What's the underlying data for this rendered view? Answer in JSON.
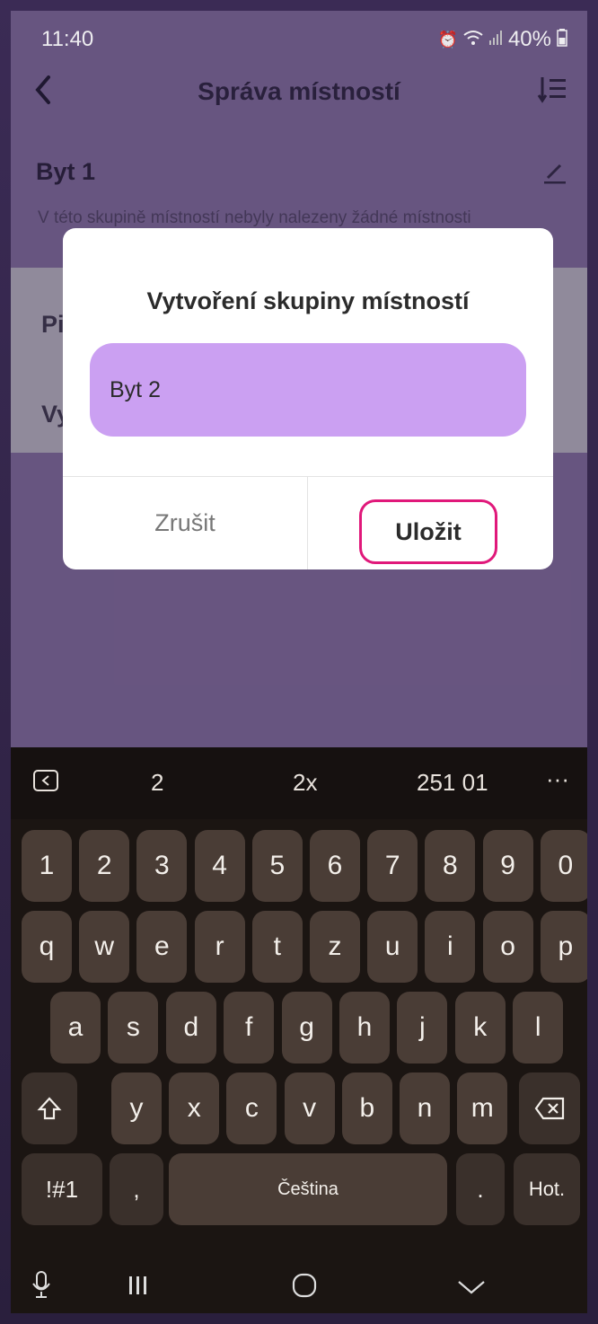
{
  "status_bar": {
    "time": "11:40",
    "battery": "40%",
    "icons": [
      "alarm-icon",
      "wifi-icon",
      "signal-icon",
      "battery-icon"
    ]
  },
  "app_bar": {
    "title": "Správa místností",
    "back_icon": "chevron-left-icon",
    "sort_icon": "sort-icon"
  },
  "group": {
    "title": "Byt 1",
    "subtitle": "V této skupině místností nebyly nalezeny žádné místnosti"
  },
  "background_rows": [
    "Pi",
    "Vy"
  ],
  "dialog": {
    "title": "Vytvoření skupiny místností",
    "input_value": "Byt 2",
    "cancel_label": "Zrušit",
    "save_label": "Uložit"
  },
  "keyboard": {
    "suggestions": [
      "2",
      "2x",
      "251 01",
      "···"
    ],
    "row1": [
      "1",
      "2",
      "3",
      "4",
      "5",
      "6",
      "7",
      "8",
      "9",
      "0"
    ],
    "row2": [
      "q",
      "w",
      "e",
      "r",
      "t",
      "z",
      "u",
      "i",
      "o",
      "p"
    ],
    "row3": [
      "a",
      "s",
      "d",
      "f",
      "g",
      "h",
      "j",
      "k",
      "l"
    ],
    "row4": [
      "y",
      "x",
      "c",
      "v",
      "b",
      "n",
      "m"
    ],
    "symbols_label": "!#1",
    "comma": ",",
    "space_label": "Čeština",
    "period": ".",
    "action_label": "Hot."
  },
  "colors": {
    "accent_field": "#cba0f2",
    "highlight": "#e0187a",
    "app_bg": "#6d5b86"
  }
}
